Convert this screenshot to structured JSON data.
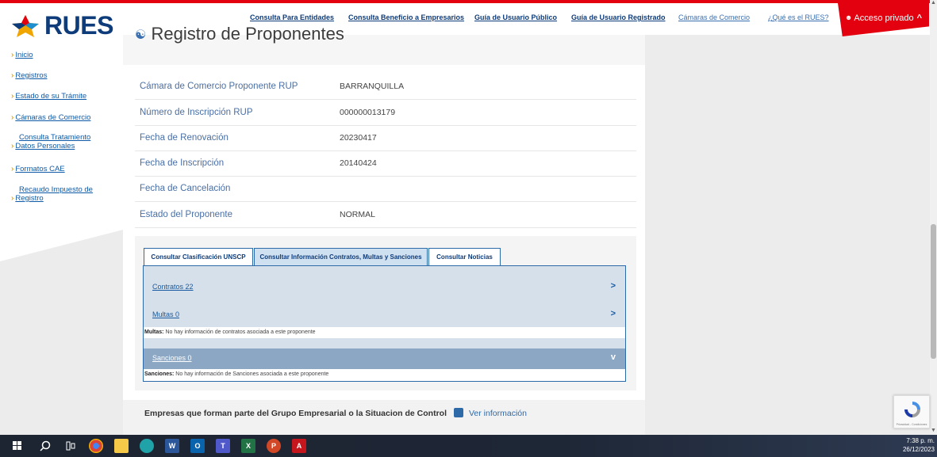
{
  "brand": {
    "logo_text": "RUES"
  },
  "colors": {
    "brand_red": "#e3000f",
    "brand_blue": "#0e3b79",
    "link_blue": "#0e5aa7",
    "chevron_yellow": "#f0a500"
  },
  "header": {
    "links": [
      "Consulta Para Entidades",
      "Consulta Beneficio a Empresarios",
      "Guía de Usuario Público",
      "Guía de Usuario Registrado",
      "Cámaras de Comercio",
      "¿Qué es el RUES?"
    ],
    "acceso": "Acceso privado"
  },
  "sidebar": {
    "items": [
      {
        "label": "Inicio"
      },
      {
        "label": "Registros"
      },
      {
        "label": "Estado de su Trámite"
      },
      {
        "label": "Cámaras de Comercio"
      },
      {
        "line1": "Consulta Tratamiento",
        "line2": "Datos Personales"
      },
      {
        "label": "Formatos CAE"
      },
      {
        "line1": "Recaudo Impuesto de",
        "line2": "Registro"
      }
    ]
  },
  "main": {
    "title": "Registro de Proponentes",
    "rows": [
      {
        "label": "Cámara de Comercio Proponente RUP",
        "value": "BARRANQUILLA"
      },
      {
        "label": "Número de Inscripción RUP",
        "value": "000000013179"
      },
      {
        "label": "Fecha de Renovación",
        "value": "20230417"
      },
      {
        "label": "Fecha de Inscripción",
        "value": "20140424"
      },
      {
        "label": "Fecha de Cancelación",
        "value": ""
      },
      {
        "label": "Estado del Proponente",
        "value": "NORMAL"
      }
    ],
    "tabs": [
      "Consultar Clasificación UNSCP",
      "Consultar Información Contratos, Multas y Sanciones",
      "Consultar Noticias"
    ],
    "accordion": {
      "contratos": "Contratos 22",
      "multas": "Multas 0",
      "multas_note_label": "Multas:",
      "multas_note": " No hay información de contratos asociada a este proponente",
      "sanciones": "Sanciones 0",
      "sanciones_note_label": "Sanciones:",
      "sanciones_note": " No hay información de Sanciones asociada a este proponente"
    },
    "grupo": {
      "text": "Empresas que forman parte del Grupo Empresarial o la Situacion de Control",
      "link": "Ver información"
    }
  },
  "recaptcha": {
    "text": "Privacidad - Condiciones"
  },
  "taskbar": {
    "time": "7:38 p. m.",
    "date": "26/12/2023",
    "apps": [
      "windows-icon",
      "search-icon",
      "task-view-icon",
      "chrome-icon",
      "file-explorer-icon",
      "edge-icon",
      "word-icon",
      "outlook-icon",
      "teams-icon",
      "excel-icon",
      "powerpoint-icon",
      "acrobat-icon"
    ]
  }
}
